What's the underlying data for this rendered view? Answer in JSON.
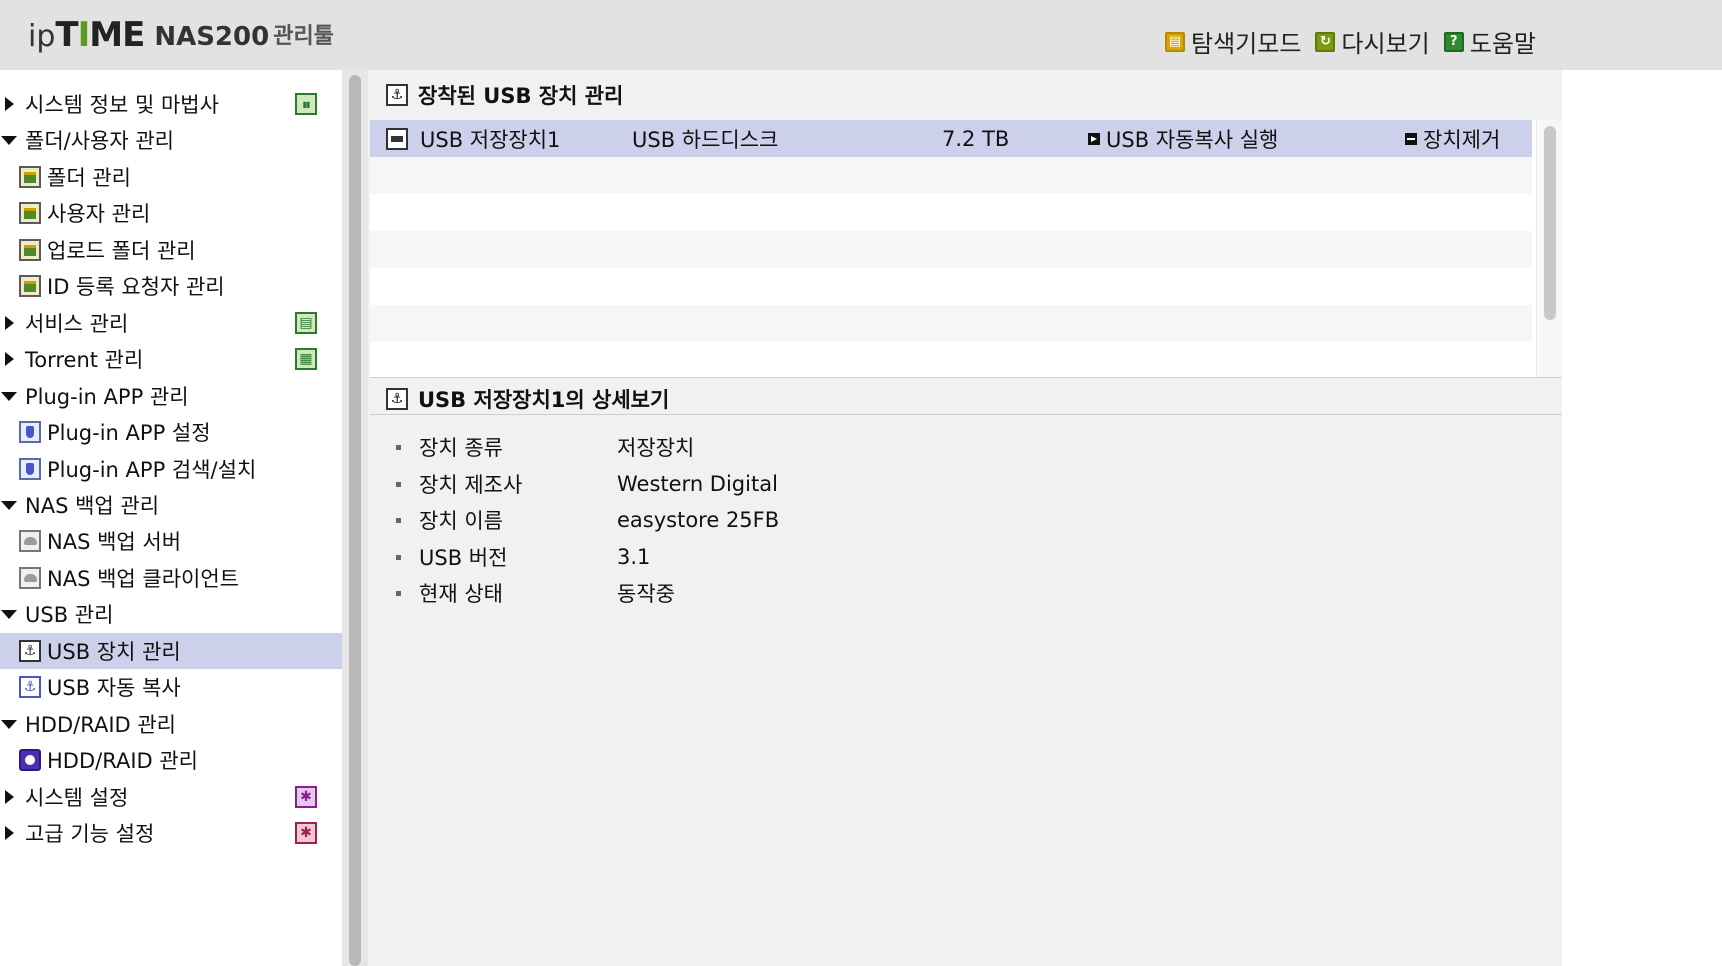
{
  "brand": {
    "prefix": "ip",
    "time_a": "T",
    "time_i": "I",
    "time_b": "ME",
    "model": "NAS200",
    "tool": "관리툴"
  },
  "header_links": [
    {
      "label": "탐색기모드",
      "icon": "explorer-mode-icon",
      "color": "#d6a800"
    },
    {
      "label": "다시보기",
      "icon": "refresh-icon",
      "color": "#7a9a10"
    },
    {
      "label": "도움말",
      "icon": "help-icon",
      "color": "#2f8a2f"
    }
  ],
  "sidebar": {
    "items": [
      {
        "label": "시스템 정보 및 마법사"
      },
      {
        "label": "폴더/사용자 관리"
      },
      {
        "label": "폴더 관리"
      },
      {
        "label": "사용자 관리"
      },
      {
        "label": "업로드 폴더 관리"
      },
      {
        "label": "ID 등록 요청자 관리"
      },
      {
        "label": "서비스 관리"
      },
      {
        "label": "Torrent 관리"
      },
      {
        "label": "Plug-in APP 관리"
      },
      {
        "label": "Plug-in APP 설정"
      },
      {
        "label": "Plug-in APP 검색/설치"
      },
      {
        "label": "NAS 백업 관리"
      },
      {
        "label": "NAS 백업 서버"
      },
      {
        "label": "NAS 백업 클라이언트"
      },
      {
        "label": "USB 관리"
      },
      {
        "label": "USB 장치 관리"
      },
      {
        "label": "USB 자동 복사"
      },
      {
        "label": "HDD/RAID 관리"
      },
      {
        "label": "HDD/RAID 관리"
      },
      {
        "label": "시스템 설정"
      },
      {
        "label": "고급 기능 설정"
      }
    ],
    "selected": "USB 장치 관리"
  },
  "main": {
    "mounted_title": "장착된 USB 장치 관리",
    "devices": [
      {
        "name": "USB 저장장치1",
        "type": "USB 하드디스크",
        "size": "7.2 TB",
        "action": "USB 자동복사 실행",
        "remove": "장치제거"
      }
    ],
    "detail_title": "USB 저장장치1의 상세보기",
    "details": [
      {
        "key": "장치 종류",
        "value": "저장장치"
      },
      {
        "key": "장치 제조사",
        "value": "Western Digital"
      },
      {
        "key": "장치 이름",
        "value": "easystore 25FB"
      },
      {
        "key": "USB 버전",
        "value": "3.1"
      },
      {
        "key": "현재 상태",
        "value": "동작중"
      }
    ]
  },
  "colors": {
    "header_bg": "#e2e2e2",
    "selection": "#cdd0eb",
    "panel_bg": "#f1f1f1"
  }
}
